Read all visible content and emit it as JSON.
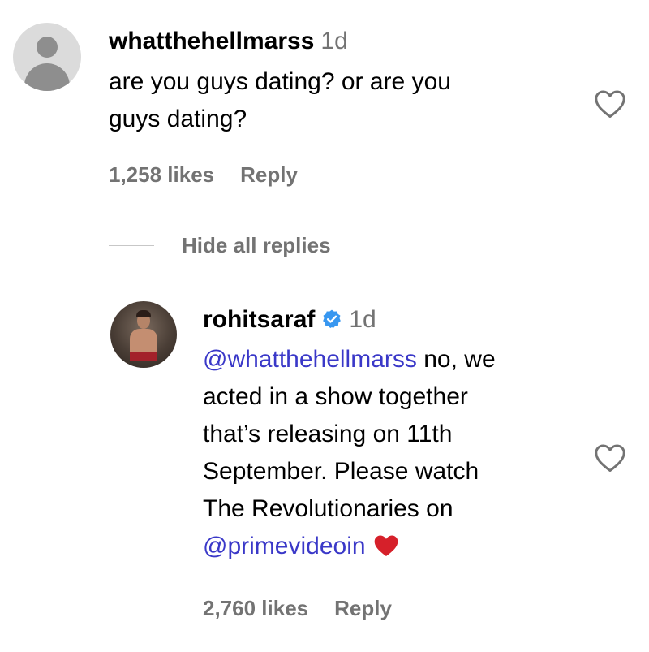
{
  "comment": {
    "username": "whatthehellmarss",
    "time": "1d",
    "text_lines": [
      "are you guys dating? or are you",
      "guys dating?"
    ],
    "likes": "1,258 likes",
    "reply_label": "Reply"
  },
  "replies_toggle": "Hide all replies",
  "reply": {
    "username": "rohitsaraf",
    "verified": true,
    "time": "1d",
    "mention": "@whatthehellmarss",
    "line1_rest": " no, we",
    "lines": [
      "acted in a show together",
      "that’s releasing on 11th",
      "September. Please watch",
      "The Revolutionaries on"
    ],
    "mention2": "@primevideoin",
    "emoji": "❤️",
    "likes": "2,760 likes",
    "reply_label": "Reply"
  },
  "colors": {
    "mention": "#3a38c8",
    "muted": "#737373",
    "verified": "#3897f0",
    "heart_emoji": "#d6202a"
  },
  "icons": [
    "default-avatar-icon",
    "heart-outline-icon",
    "verified-badge-icon",
    "red-heart-emoji"
  ]
}
